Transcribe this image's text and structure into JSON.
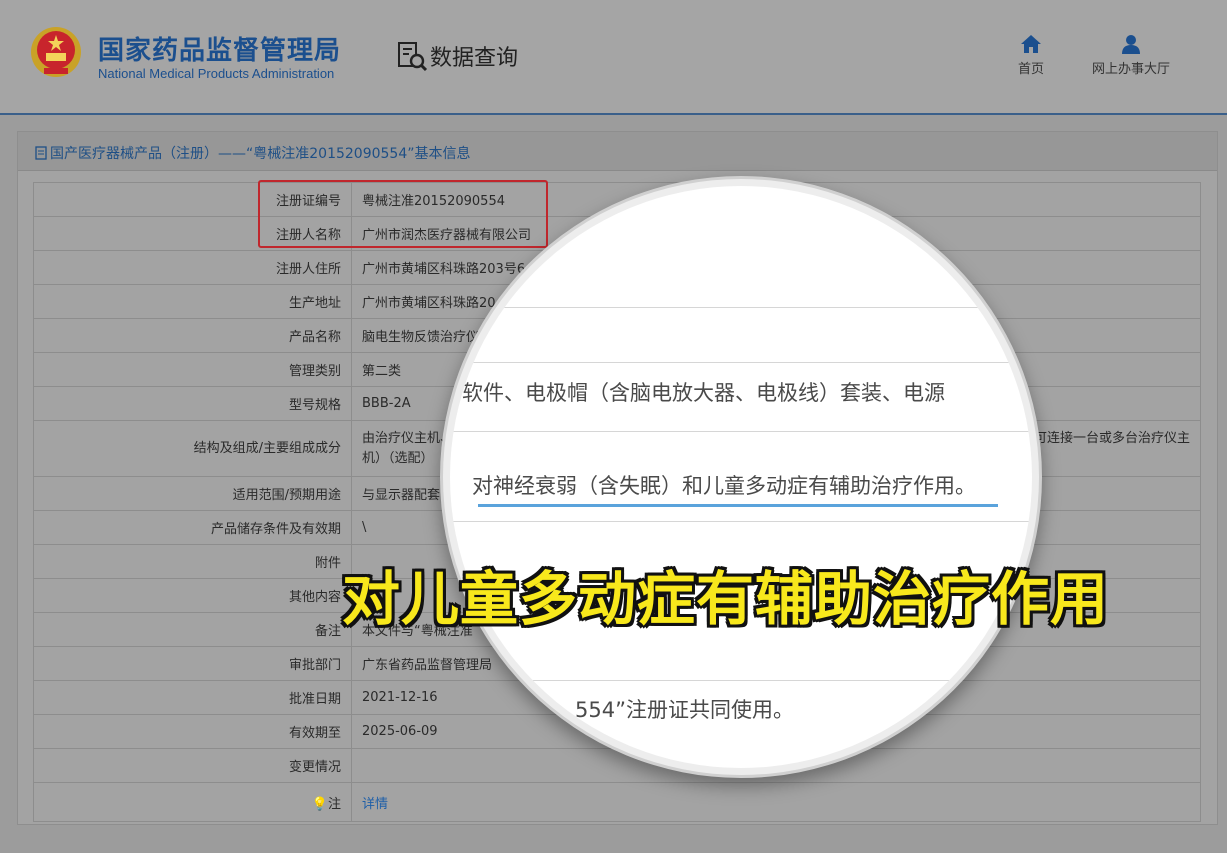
{
  "header": {
    "agency_cn": "国家药品监督管理局",
    "agency_en": "National Medical Products Administration",
    "data_query": "数据查询",
    "nav": [
      {
        "label": "首页",
        "icon": "home-icon"
      },
      {
        "label": "网上办事大厅",
        "icon": "user-icon"
      }
    ]
  },
  "panel": {
    "title": "国产医疗器械产品（注册）——“粤械注准20152090554”基本信息"
  },
  "rows": [
    {
      "label": "注册证编号",
      "value": "粤械注准20152090554"
    },
    {
      "label": "注册人名称",
      "value": "广州市润杰医疗器械有限公司"
    },
    {
      "label": "注册人住所",
      "value": "广州市黄埔区科珠路203号6"
    },
    {
      "label": "生产地址",
      "value": "广州市黄埔区科珠路20"
    },
    {
      "label": "产品名称",
      "value": "脑电生物反馈治疗仪"
    },
    {
      "label": "管理类别",
      "value": "第二类"
    },
    {
      "label": "型号规格",
      "value": "BBB-2A"
    },
    {
      "label": "结构及组成/主要组成成分",
      "value": "由治疗仪主机、",
      "value_right": "可连接一台或多台治疗仪主",
      "value_line2": "机）（选配）"
    },
    {
      "label": "适用范围/预期用途",
      "value": "与显示器配套"
    },
    {
      "label": "产品储存条件及有效期",
      "value": "\\"
    },
    {
      "label": "附件",
      "value": ""
    },
    {
      "label": "其他内容",
      "value": ""
    },
    {
      "label": "备注",
      "value": "本文件与“粤械注准"
    },
    {
      "label": "审批部门",
      "value": "广东省药品监督管理局"
    },
    {
      "label": "批准日期",
      "value": "2021-12-16"
    },
    {
      "label": "有效期至",
      "value": "2025-06-09"
    },
    {
      "label": "变更情况",
      "value": ""
    },
    {
      "label": "注",
      "value": "详情"
    }
  ],
  "magnifier": {
    "line_structure": "软件、电极帽（含脑电放大器、电极线）套装、电源",
    "line_usage": "对神经衰弱（含失眠）和儿童多动症有辅助治疗作用。",
    "line_note": "554”注册证共同使用。"
  },
  "caption": "对儿童多动症有辅助治疗作用",
  "colors": {
    "brand_blue": "#1b4f8e",
    "highlight_red": "#c0272d",
    "caption_yellow": "#f8e81c",
    "underline_blue": "#5aa3dc"
  }
}
